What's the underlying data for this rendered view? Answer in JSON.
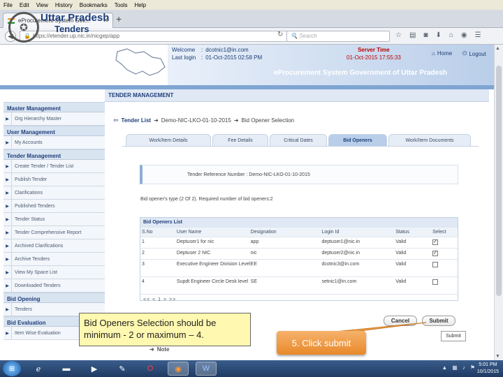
{
  "menu": [
    "File",
    "Edit",
    "View",
    "History",
    "Bookmarks",
    "Tools",
    "Help"
  ],
  "browser": {
    "tab_title": "eProcurement System Gov...",
    "url": "https://etender.up.nic.in/nicgep/app",
    "search_placeholder": "Search"
  },
  "header": {
    "brand_line1": "Uttar Pradesh",
    "brand_line2": "Tenders",
    "welcome_label": "Welcome",
    "welcome_value": "dcotnic1@in.com",
    "lastlogin_label": "Last login",
    "lastlogin_value": "01-Oct-2015 02:58 PM",
    "server_time_label": "Server Time",
    "server_time_value": "01-Oct-2015 17:55:33",
    "home": "Home",
    "logout": "Logout",
    "system_title": "eProcurement System Government of Uttar Pradesh"
  },
  "sidebar": {
    "sections": [
      {
        "title": "Master Management",
        "items": [
          "Org Hierarchy Master"
        ]
      },
      {
        "title": "User Management",
        "items": [
          "My Accounts"
        ]
      },
      {
        "title": "Tender Management",
        "items": [
          "Create Tender / Tender List",
          "Publish Tender",
          "Clarifications",
          "Published Tenders",
          "Tender Status",
          "Tender Comprehensive Report",
          "Archived Clarifications",
          "Archive Tenders",
          "View My Space List",
          "Downloaded Tenders"
        ]
      },
      {
        "title": "Bid Opening",
        "items": [
          "Tenders"
        ]
      },
      {
        "title": "Bid Evaluation",
        "items": [
          "Item Wise Evaluation"
        ]
      }
    ]
  },
  "main": {
    "section_title": "TENDER MANAGEMENT",
    "breadcrumb": [
      "Tender List",
      "Demo-NIC-LKO-01-10-2015",
      "Bid Opener Selection"
    ],
    "tabs": [
      "Work/Item Details",
      "Fee Details",
      "Critical Dates",
      "Bid Openers",
      "Work/Item Documents"
    ],
    "active_tab": 3,
    "reference": "Tender Reference Number : Demo-NIC-LKO-01-10-2015",
    "note": "Bid opener's type (2 Of 2). Required number of bid openers:2",
    "list_title": "Bid Openers List",
    "columns": [
      "S.No",
      "User Name",
      "Designation",
      "Login Id",
      "Status",
      "Select"
    ],
    "rows": [
      {
        "sno": "1",
        "name": "Deptuser1 for nic",
        "designation": "app",
        "login": "deptuser1@nic.in",
        "status": "Valid",
        "checked": true
      },
      {
        "sno": "2",
        "name": "Deptuser 2 NIC",
        "designation": "nic",
        "login": "deptuser2@nic.in",
        "status": "Valid",
        "checked": true
      },
      {
        "sno": "3",
        "name": "Executive Engineer Division Level",
        "designation": "EE",
        "login": "dcotnic3@in.com",
        "status": "Valid",
        "checked": false
      },
      {
        "sno": "4",
        "name": "Supdt Engineer Circle Desk level",
        "designation": "SE",
        "login": "setnic1@in.com",
        "status": "Valid",
        "checked": false
      }
    ],
    "pager": "<< < 1 > >>",
    "cancel": "Cancel",
    "submit": "Submit",
    "submit_plain": "Submit",
    "note_label": "Note"
  },
  "callouts": {
    "yellow": "Bid Openers Selection should be minimum - 2 or maximum – 4.",
    "orange": "5. Click submit"
  },
  "taskbar": {
    "time": "5:01 PM",
    "date": "10/1/2015"
  },
  "colors": {
    "brand": "#1f3f7a",
    "accent_orange": "#e8892a",
    "callout_yellow": "#fff8b0",
    "server_time": "#bb0000"
  }
}
